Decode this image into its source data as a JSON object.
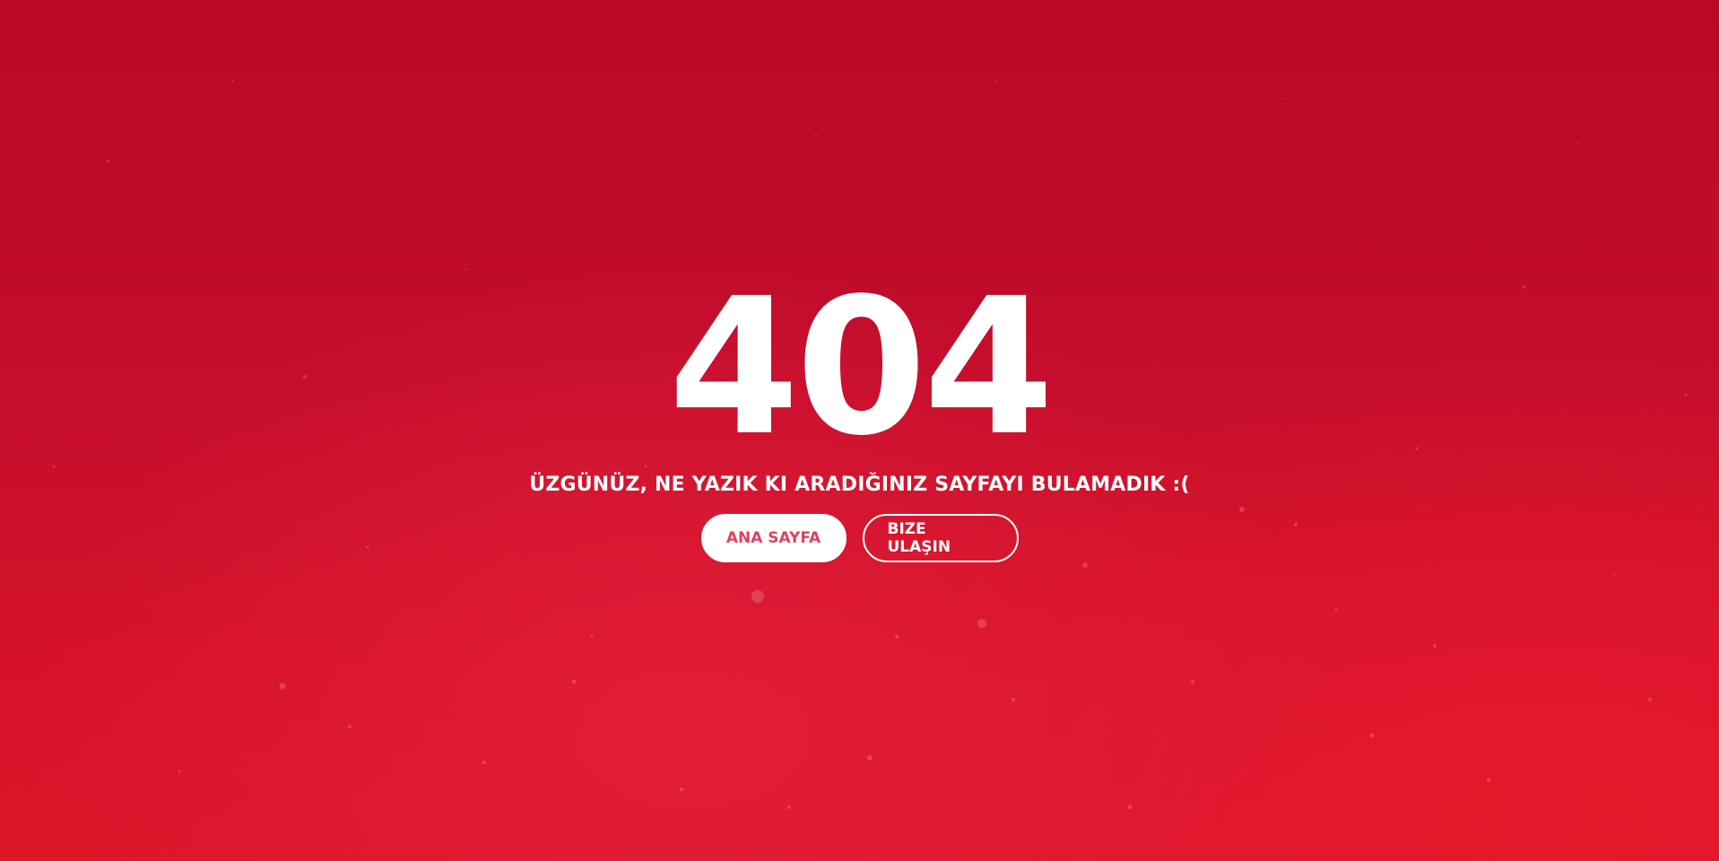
{
  "error_code": "404",
  "message": "ÜZGÜNÜZ, NE YAZIK KI ARADIĞINIZ SAYFAYI BULAMADIK :(",
  "buttons": {
    "home_label": "ANA SAYFA",
    "contact_label": "BIZE ULAŞIN"
  },
  "colors": {
    "background": "#c20d2c",
    "text": "#ffffff",
    "primary_button_text": "#e0405e"
  }
}
